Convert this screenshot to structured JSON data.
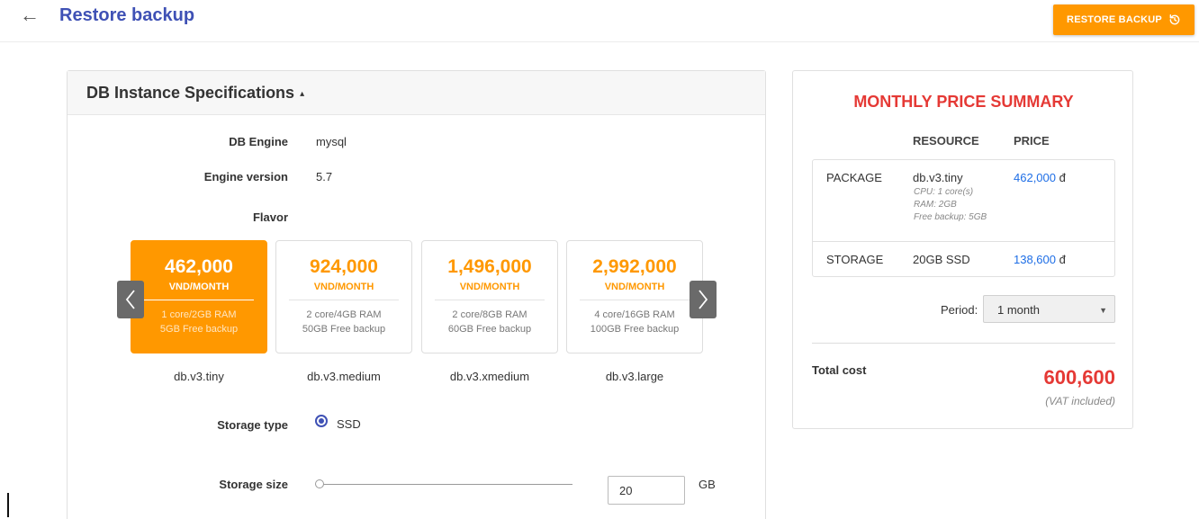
{
  "header": {
    "title": "Restore backup",
    "back_icon": "arrow-left-icon",
    "restore_button_label": "RESTORE BACKUP",
    "restore_icon": "history-icon",
    "accent_color": "#ff9800",
    "title_color": "#3f51b5"
  },
  "spec": {
    "title": "DB Instance Specifications",
    "caret": "▴",
    "db_engine_label": "DB Engine",
    "db_engine_value": "mysql",
    "engine_version_label": "Engine version",
    "engine_version_value": "5.7",
    "flavor_label": "Flavor",
    "flavors": [
      {
        "price": "462,000",
        "unit": "VND/MONTH",
        "cpu_ram": "1 core/2GB RAM",
        "backup": "5GB Free backup",
        "name": "db.v3.tiny",
        "selected": true
      },
      {
        "price": "924,000",
        "unit": "VND/MONTH",
        "cpu_ram": "2 core/4GB RAM",
        "backup": "50GB Free backup",
        "name": "db.v3.medium",
        "selected": false
      },
      {
        "price": "1,496,000",
        "unit": "VND/MONTH",
        "cpu_ram": "2 core/8GB RAM",
        "backup": "60GB Free backup",
        "name": "db.v3.xmedium",
        "selected": false
      },
      {
        "price": "2,992,000",
        "unit": "VND/MONTH",
        "cpu_ram": "4 core/16GB RAM",
        "backup": "100GB Free backup",
        "name": "db.v3.large",
        "selected": false
      }
    ],
    "storage_type_label": "Storage type",
    "storage_type_value": "SSD",
    "storage_size_label": "Storage size",
    "storage_size_value": "20",
    "storage_size_unit": "GB",
    "storage_slider_fraction": 0.0
  },
  "summary": {
    "title": "MONTHLY PRICE SUMMARY",
    "col_resource": "RESOURCE",
    "col_price": "PRICE",
    "rows": [
      {
        "type": "PACKAGE",
        "resource": "db.v3.tiny",
        "details": [
          "CPU: 1 core(s)",
          "RAM: 2GB",
          "Free backup: 5GB"
        ],
        "price": "462,000",
        "currency": "đ"
      },
      {
        "type": "STORAGE",
        "resource": "20GB SSD",
        "price": "138,600",
        "currency": "đ"
      }
    ],
    "period_label": "Period:",
    "period_value": "1 month",
    "total_label": "Total cost",
    "total_value": "600,600",
    "vat_note": "(VAT included)",
    "title_color": "#e53935",
    "price_link_color": "#1e6ee6"
  }
}
